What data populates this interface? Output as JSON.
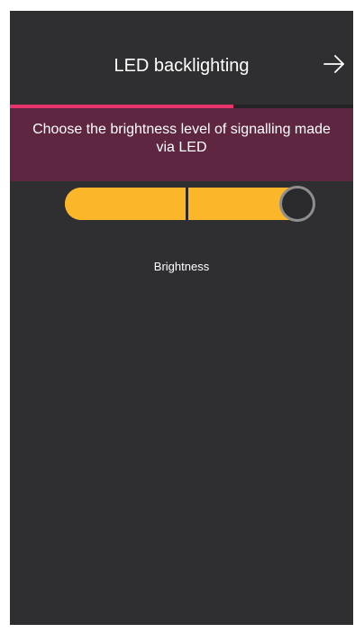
{
  "header": {
    "title": "LED backlighting",
    "next_icon": "arrow-right-icon"
  },
  "wizard_progress": {
    "fraction": 0.65,
    "color": "#e8336b"
  },
  "banner": {
    "text": "Choose the brightness level of signalling made via LED",
    "background": "#5e2640"
  },
  "brightness_slider": {
    "label": "Brightness",
    "value_fraction": 1.0,
    "accent": "#fbb62a"
  }
}
